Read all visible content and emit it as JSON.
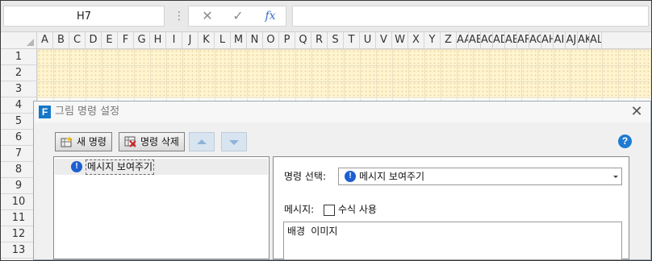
{
  "formula_bar": {
    "cell_ref": "H7",
    "menu_icon": "vertical-dots-icon",
    "cancel_glyph": "✕",
    "confirm_glyph": "✓",
    "fx_label": "fx",
    "formula_value": ""
  },
  "sheet": {
    "columns": [
      "A",
      "B",
      "C",
      "D",
      "E",
      "F",
      "G",
      "H",
      "I",
      "J",
      "K",
      "L",
      "M",
      "N",
      "O",
      "P",
      "Q",
      "R",
      "S",
      "T",
      "U",
      "V",
      "W",
      "X",
      "Y",
      "Z",
      "AA",
      "AB",
      "AC",
      "AD",
      "AE",
      "AF",
      "AG",
      "AH",
      "AI",
      "AJ",
      "AK",
      "AL"
    ],
    "rows": [
      "1",
      "2",
      "3",
      "4",
      "5",
      "6",
      "7",
      "8",
      "9",
      "10",
      "11",
      "12",
      "13"
    ],
    "highlight_color": "#fff4cf"
  },
  "dialog": {
    "app_icon_letter": "F",
    "title": "그림 명령 설정",
    "close_glyph": "✕",
    "toolbar": {
      "new_command": "새 명령",
      "delete_command": "명령 삭제",
      "help_glyph": "?"
    },
    "command_list": [
      {
        "label": "메시지 보여주기",
        "icon": "info-icon"
      }
    ],
    "properties": {
      "command_select_label": "명령 선택:",
      "command_select_value": "메시지 보여주기",
      "message_label": "메시지:",
      "formula_checkbox_label": "수식 사용",
      "formula_checkbox_checked": false,
      "message_text": "배경 이미지"
    }
  },
  "colors": {
    "accent_blue": "#1677c9",
    "info_blue": "#1d5fd0"
  }
}
